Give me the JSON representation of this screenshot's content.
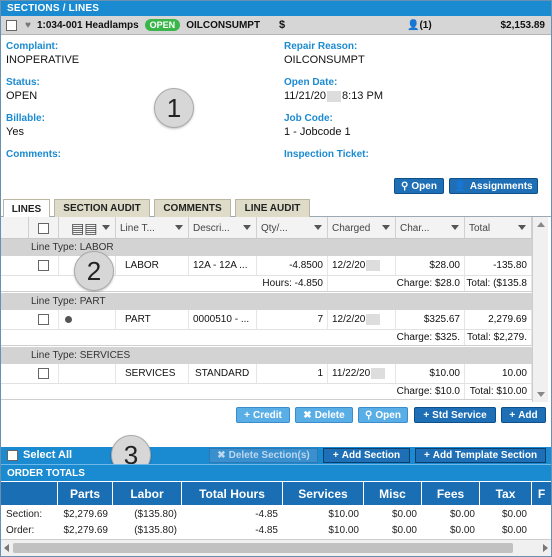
{
  "header": {
    "title": "SECTIONS / LINES"
  },
  "section": {
    "code": "1:034-001 Headlamps",
    "status": "OPEN",
    "concern": "OILCONSUMPT",
    "dollar_icon": "$",
    "techs": "(1)",
    "amount": "$2,153.89"
  },
  "details": {
    "complaint_label": "Complaint:",
    "complaint": "INOPERATIVE",
    "repair_reason_label": "Repair Reason:",
    "repair_reason": "OILCONSUMPT",
    "status_label": "Status:",
    "status": "OPEN",
    "open_date_label": "Open Date:",
    "open_date_a": "11/21/20",
    "open_date_b": "8:13 PM",
    "billable_label": "Billable:",
    "billable": "Yes",
    "job_code_label": "Job Code:",
    "job_code": "1 - Jobcode 1",
    "comments_label": "Comments:",
    "inspection_label": "Inspection Ticket:"
  },
  "callouts": {
    "one": "1",
    "two": "2",
    "three": "3"
  },
  "actions": {
    "open": "Open",
    "assignments": "Assignments"
  },
  "tabs": [
    "LINES",
    "SECTION AUDIT",
    "COMMENTS",
    "LINE AUDIT"
  ],
  "grid": {
    "columns": [
      "Line T...",
      "Descri...",
      "Qty/...",
      "Charged",
      "Char...",
      "Total"
    ],
    "groups": [
      {
        "label": "Line Type: LABOR",
        "type": "LABOR",
        "desc": "12A - 12A ...",
        "qty": "-4.8500",
        "charged": "12/2/20",
        "charge": "$28.00",
        "total": "-135.80",
        "sub_qty": "Hours: -4.850",
        "sub_charge": "Charge: $28.0",
        "sub_total": "Total: ($135.8"
      },
      {
        "label": "Line Type: PART",
        "type": "PART",
        "desc": "0000510 - ...",
        "qty": "7",
        "charged": "12/2/20",
        "charge": "$325.67",
        "total": "2,279.69",
        "sub_qty": "",
        "sub_charge": "Charge: $325.",
        "sub_total": "Total: $2,279."
      },
      {
        "label": "Line Type: SERVICES",
        "type": "SERVICES",
        "desc": "STANDARD",
        "qty": "1",
        "charged": "11/22/20",
        "charge": "$10.00",
        "total": "10.00",
        "sub_qty": "",
        "sub_charge": "Charge: $10.0",
        "sub_total": "Total: $10.00"
      }
    ]
  },
  "line_buttons": {
    "credit": "Credit",
    "delete": "Delete",
    "open": "Open",
    "std_service": "Std Service",
    "add": "Add"
  },
  "section_bar": {
    "select_all": "Select All",
    "delete_sections": "Delete Section(s)",
    "add_section": "Add Section",
    "add_template": "Add Template Section"
  },
  "totals": {
    "title": "ORDER TOTALS",
    "columns": [
      "Parts",
      "Labor",
      "Total Hours",
      "Services",
      "Misc",
      "Fees",
      "Tax",
      "F"
    ],
    "rows": [
      {
        "label": "Section:",
        "values": [
          "$2,279.69",
          "($135.80)",
          "-4.85",
          "$10.00",
          "$0.00",
          "$0.00",
          "$0.00"
        ]
      },
      {
        "label": "Order:",
        "values": [
          "$2,279.69",
          "($135.80)",
          "-4.85",
          "$10.00",
          "$0.00",
          "$0.00",
          "$0.00"
        ]
      }
    ]
  }
}
